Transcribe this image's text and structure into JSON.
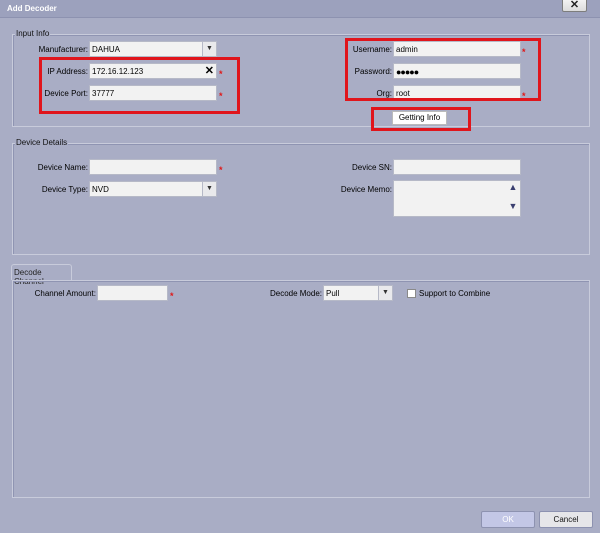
{
  "window": {
    "title": "Add Decoder",
    "close_icon": "✕"
  },
  "input_info": {
    "legend": "Input Info",
    "manufacturer": {
      "label": "Manufacturer:",
      "value": "DAHUA"
    },
    "ip_address": {
      "label": "IP Address:",
      "value": "172.16.12.123"
    },
    "device_port": {
      "label": "Device Port:",
      "value": "37777"
    },
    "username": {
      "label": "Username:",
      "value": "admin"
    },
    "password": {
      "label": "Password:",
      "value": "●●●●●"
    },
    "org": {
      "label": "Org:",
      "value": "root"
    },
    "getting_info_label": "Getting Info"
  },
  "device_details": {
    "legend": "Device Details",
    "device_name": {
      "label": "Device Name:",
      "value": ""
    },
    "device_type": {
      "label": "Device Type:",
      "value": "NVD"
    },
    "device_sn": {
      "label": "Device SN:",
      "value": ""
    },
    "device_memo": {
      "label": "Device Memo:",
      "value": ""
    }
  },
  "decode_channel": {
    "tab_label": "Decode Channel",
    "channel_amount": {
      "label": "Channel Amount:",
      "value": ""
    },
    "decode_mode": {
      "label": "Decode Mode:",
      "value": "Pull"
    },
    "support_to_combine": {
      "label": "Support to Combine",
      "checked": false
    }
  },
  "footer": {
    "ok_label": "OK",
    "cancel_label": "Cancel"
  },
  "required_marker": "*",
  "colors": {
    "required": "#e01818",
    "highlight_box": "#e0151c",
    "background": "#a9adc5"
  }
}
